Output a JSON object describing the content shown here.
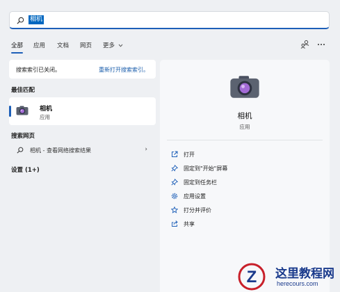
{
  "search": {
    "query": "相机"
  },
  "tabs": [
    "全部",
    "应用",
    "文档",
    "网页",
    "更多"
  ],
  "index_notice": {
    "message": "搜索索引已关闭。",
    "link": "重新打开搜索索引。"
  },
  "sections": {
    "best_match": "最佳匹配",
    "web": "搜索网页",
    "settings": "设置 (1+)"
  },
  "best_match": {
    "name": "相机",
    "type": "应用"
  },
  "web_result": {
    "text": "相机 - 查看网络搜索结果"
  },
  "detail": {
    "name": "相机",
    "type": "应用",
    "actions": [
      {
        "label": "打开",
        "icon": "open-icon"
      },
      {
        "label": "固定到\"开始\"屏幕",
        "icon": "pin-icon"
      },
      {
        "label": "固定到任务栏",
        "icon": "pin-icon"
      },
      {
        "label": "应用设置",
        "icon": "gear-icon"
      },
      {
        "label": "打分并评价",
        "icon": "star-icon"
      },
      {
        "label": "共享",
        "icon": "share-icon"
      }
    ]
  },
  "watermark": {
    "title": "这里教程网",
    "url": "herecours.com"
  },
  "colors": {
    "accent": "#1d5fb8",
    "link": "#1a5dab",
    "background": "#eef0f3"
  }
}
